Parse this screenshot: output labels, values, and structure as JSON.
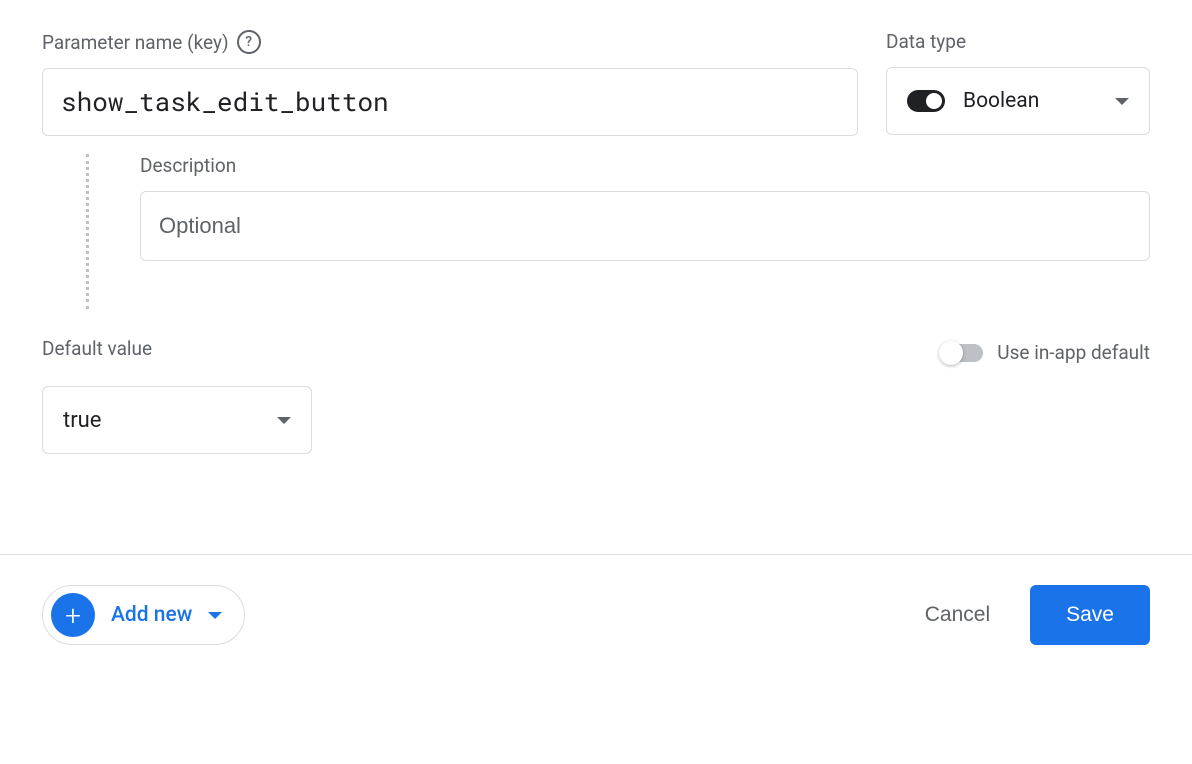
{
  "paramName": {
    "label": "Parameter name (key)",
    "value": "show_task_edit_button"
  },
  "dataType": {
    "label": "Data type",
    "selected": "Boolean"
  },
  "description": {
    "label": "Description",
    "placeholder": "Optional",
    "value": ""
  },
  "defaultValue": {
    "label": "Default value",
    "selected": "true"
  },
  "inAppDefault": {
    "label": "Use in-app default",
    "enabled": false
  },
  "footer": {
    "addNew": "Add new",
    "cancel": "Cancel",
    "save": "Save"
  }
}
